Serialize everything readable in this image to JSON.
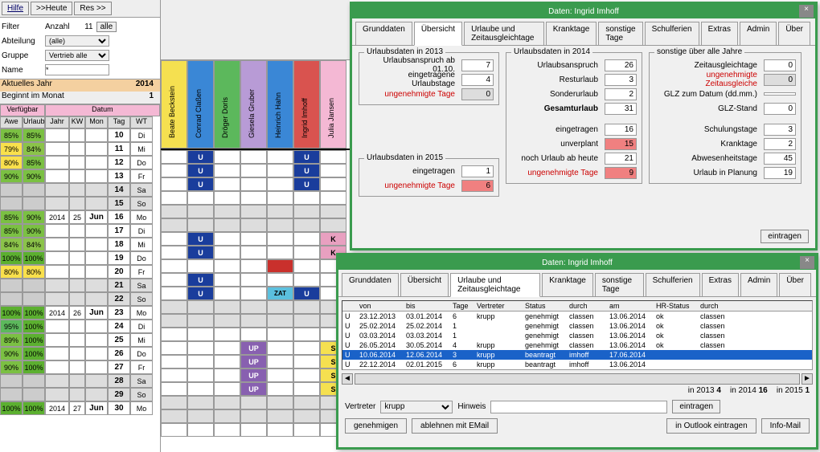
{
  "buttons": {
    "hilfe": "Hilfe",
    "heute": ">>Heute",
    "res": "Res >>",
    "alle": "alle"
  },
  "filter": {
    "label": "Filter",
    "anzahl_lbl": "Anzahl",
    "anzahl": "11",
    "abteilung_lbl": "Abteilung",
    "abteilung": "(alle)",
    "gruppe_lbl": "Gruppe",
    "gruppe": "Vertrieb alle",
    "name_lbl": "Name",
    "name": "*"
  },
  "year": {
    "jahr_lbl": "Aktuelles Jahr",
    "jahr": "2014",
    "beginn_lbl": "Beginnt im Monat",
    "beginn": "1"
  },
  "pink": {
    "verfugbar": "Verfügbar",
    "datum": "Datum"
  },
  "gh": {
    "awe": "Awe",
    "urlaub": "Urlaub",
    "jahr": "Jahr",
    "kw": "KW",
    "mon": "Mon",
    "tag": "Tag",
    "wt": "WT"
  },
  "rows": [
    {
      "a": "85%",
      "b": "85%",
      "j": "",
      "kw": "",
      "m": "",
      "t": "10",
      "w": "Di",
      "ac": "g85",
      "bc": "g85"
    },
    {
      "a": "79%",
      "b": "84%",
      "j": "",
      "kw": "",
      "m": "",
      "t": "11",
      "w": "Mi",
      "ac": "g79",
      "bc": "g84"
    },
    {
      "a": "80%",
      "b": "85%",
      "j": "",
      "kw": "",
      "m": "",
      "t": "12",
      "w": "Do",
      "ac": "g80",
      "bc": "g85"
    },
    {
      "a": "90%",
      "b": "90%",
      "j": "",
      "kw": "",
      "m": "",
      "t": "13",
      "w": "Fr",
      "ac": "g90",
      "bc": "g90"
    },
    {
      "a": "",
      "b": "",
      "j": "",
      "kw": "",
      "m": "",
      "t": "14",
      "w": "Sa",
      "ac": "gray",
      "bc": "gray",
      "gray": true
    },
    {
      "a": "",
      "b": "",
      "j": "",
      "kw": "",
      "m": "",
      "t": "15",
      "w": "So",
      "ac": "gray",
      "bc": "gray",
      "gray": true
    },
    {
      "a": "85%",
      "b": "90%",
      "j": "2014",
      "kw": "25",
      "m": "Jun",
      "t": "16",
      "w": "Mo",
      "ac": "g85",
      "bc": "g90"
    },
    {
      "a": "85%",
      "b": "90%",
      "j": "",
      "kw": "",
      "m": "",
      "t": "17",
      "w": "Di",
      "ac": "g85",
      "bc": "g90"
    },
    {
      "a": "84%",
      "b": "84%",
      "j": "",
      "kw": "",
      "m": "",
      "t": "18",
      "w": "Mi",
      "ac": "g84",
      "bc": "g84"
    },
    {
      "a": "100%",
      "b": "100%",
      "j": "",
      "kw": "",
      "m": "",
      "t": "19",
      "w": "Do",
      "ac": "g100",
      "bc": "g100"
    },
    {
      "a": "80%",
      "b": "80%",
      "j": "",
      "kw": "",
      "m": "",
      "t": "20",
      "w": "Fr",
      "ac": "g80",
      "bc": "g80"
    },
    {
      "a": "",
      "b": "",
      "j": "",
      "kw": "",
      "m": "",
      "t": "21",
      "w": "Sa",
      "ac": "gray",
      "bc": "gray",
      "gray": true
    },
    {
      "a": "",
      "b": "",
      "j": "",
      "kw": "",
      "m": "",
      "t": "22",
      "w": "So",
      "ac": "gray",
      "bc": "gray",
      "gray": true
    },
    {
      "a": "100%",
      "b": "100%",
      "j": "2014",
      "kw": "26",
      "m": "Jun",
      "t": "23",
      "w": "Mo",
      "ac": "g100",
      "bc": "g100"
    },
    {
      "a": "95%",
      "b": "100%",
      "j": "",
      "kw": "",
      "m": "",
      "t": "24",
      "w": "Di",
      "ac": "g95",
      "bc": "g100"
    },
    {
      "a": "89%",
      "b": "100%",
      "j": "",
      "kw": "",
      "m": "",
      "t": "25",
      "w": "Mi",
      "ac": "g89",
      "bc": "g100"
    },
    {
      "a": "90%",
      "b": "100%",
      "j": "",
      "kw": "",
      "m": "",
      "t": "26",
      "w": "Do",
      "ac": "g90",
      "bc": "g100"
    },
    {
      "a": "90%",
      "b": "100%",
      "j": "",
      "kw": "",
      "m": "",
      "t": "27",
      "w": "Fr",
      "ac": "g90",
      "bc": "g100"
    },
    {
      "a": "",
      "b": "",
      "j": "",
      "kw": "",
      "m": "",
      "t": "28",
      "w": "Sa",
      "ac": "gray",
      "bc": "gray",
      "gray": true
    },
    {
      "a": "",
      "b": "",
      "j": "",
      "kw": "",
      "m": "",
      "t": "29",
      "w": "So",
      "ac": "gray",
      "bc": "gray",
      "gray": true
    },
    {
      "a": "100%",
      "b": "100%",
      "j": "2014",
      "kw": "27",
      "m": "Jun",
      "t": "30",
      "w": "Mo",
      "ac": "g100",
      "bc": "g100"
    }
  ],
  "people": [
    "Beate Beckstein",
    "Conrad Claßen",
    "Dröger Doris",
    "Giesela Gruber",
    "Heinrich Hahn",
    "Ingrid Imhoff",
    "Julia Jansen"
  ],
  "pcolors": [
    "c-yellow",
    "c-blue",
    "c-green",
    "c-purple",
    "c-blue",
    "c-red",
    "c-pink"
  ],
  "gantt": [
    [
      "",
      "U",
      "",
      "",
      "",
      "U",
      ""
    ],
    [
      "",
      "U",
      "",
      "",
      "",
      "U",
      ""
    ],
    [
      "",
      "U",
      "",
      "",
      "",
      "U",
      ""
    ],
    [
      "",
      "",
      "",
      "",
      "",
      "",
      ""
    ],
    [
      "g",
      "g",
      "g",
      "g",
      "g",
      "g",
      "g"
    ],
    [
      "g",
      "g",
      "g",
      "g",
      "g",
      "g",
      "g"
    ],
    [
      "",
      "U",
      "",
      "",
      "",
      "",
      "K"
    ],
    [
      "",
      "U",
      "",
      "",
      "",
      "",
      "K"
    ],
    [
      "",
      "",
      "",
      "",
      "r",
      "",
      ""
    ],
    [
      "",
      "U",
      "",
      "",
      "",
      "",
      ""
    ],
    [
      "",
      "U",
      "",
      "",
      "ZAT",
      "U",
      ""
    ],
    [
      "g",
      "g",
      "g",
      "g",
      "g",
      "g",
      "g"
    ],
    [
      "g",
      "g",
      "g",
      "g",
      "g",
      "g",
      "g"
    ],
    [
      "",
      "",
      "",
      "",
      "",
      "",
      ""
    ],
    [
      "",
      "",
      "",
      "UP",
      "",
      "",
      "S"
    ],
    [
      "",
      "",
      "",
      "UP",
      "",
      "",
      "S"
    ],
    [
      "",
      "",
      "",
      "UP",
      "",
      "",
      "S"
    ],
    [
      "",
      "",
      "",
      "UP",
      "",
      "",
      "S"
    ],
    [
      "g",
      "g",
      "g",
      "g",
      "g",
      "g",
      "g"
    ],
    [
      "g",
      "g",
      "g",
      "g",
      "g",
      "g",
      "g"
    ],
    [
      "",
      "",
      "",
      "",
      "",
      "",
      ""
    ]
  ],
  "m1": {
    "title": "Daten: Ingrid Imhoff",
    "tabs": [
      "Grunddaten",
      "Übersicht",
      "Urlaube und Zeitausgleichtage",
      "Kranktage",
      "sonstige Tage",
      "Schulferien",
      "Extras",
      "Admin",
      "Über"
    ],
    "active": 1,
    "f2013": {
      "legend": "Urlaubsdaten in 2013",
      "anspruch_lbl": "Urlaubsanspruch ab 01.10.",
      "anspruch": "7",
      "einget_lbl": "eingetragene Urlaubstage",
      "einget": "4",
      "ungen_lbl": "ungenehmigte Tage",
      "ungen": "0"
    },
    "f2015": {
      "legend": "Urlaubsdaten in 2015",
      "einget_lbl": "eingetragen",
      "einget": "1",
      "ungen_lbl": "ungenehmigte Tage",
      "ungen": "6"
    },
    "f2014": {
      "legend": "Urlaubsdaten in 2014",
      "anspruch_lbl": "Urlaubsanspruch",
      "anspruch": "26",
      "rest_lbl": "Resturlaub",
      "rest": "3",
      "sonder_lbl": "Sonderurlaub",
      "sonder": "2",
      "gesamt_lbl": "Gesamturlaub",
      "gesamt": "31",
      "einget_lbl": "eingetragen",
      "einget": "16",
      "unver_lbl": "unverplant",
      "unver": "15",
      "noch_lbl": "noch Urlaub ab heute",
      "noch": "21",
      "ungen_lbl": "ungenehmigte Tage",
      "ungen": "9"
    },
    "fson": {
      "legend": "sonstige über alle Jahre",
      "zeit_lbl": "Zeitausgleichtage",
      "zeit": "0",
      "uza_lbl": "ungenehmigte Zeitausgleiche",
      "uza": "0",
      "glzd_lbl": "GLZ zum Datum (dd.mm.)",
      "glzd": "",
      "glzs_lbl": "GLZ-Stand",
      "glzs": "0",
      "schul_lbl": "Schulungstage",
      "schul": "3",
      "krank_lbl": "Kranktage",
      "krank": "2",
      "abw_lbl": "Abwesenheitstage",
      "abw": "45",
      "plan_lbl": "Urlaub in Planung",
      "plan": "19"
    },
    "eintragen": "eintragen"
  },
  "m2": {
    "title": "Daten: Ingrid Imhoff",
    "tabs": [
      "Grunddaten",
      "Übersicht",
      "Urlaube und Zeitausgleichtage",
      "Kranktage",
      "sonstige Tage",
      "Schulferien",
      "Extras",
      "Admin",
      "Über"
    ],
    "active": 2,
    "th": [
      "",
      "von",
      "bis",
      "Tage",
      "Vertreter",
      "Status",
      "durch",
      "am",
      "HR-Status",
      "durch"
    ],
    "rows": [
      [
        "U",
        "23.12.2013",
        "03.01.2014",
        "6",
        "krupp",
        "genehmigt",
        "classen",
        "13.06.2014",
        "ok",
        "classen"
      ],
      [
        "U",
        "25.02.2014",
        "25.02.2014",
        "1",
        "",
        "genehmigt",
        "classen",
        "13.06.2014",
        "ok",
        "classen"
      ],
      [
        "U",
        "03.03.2014",
        "03.03.2014",
        "1",
        "",
        "genehmigt",
        "classen",
        "13.06.2014",
        "ok",
        "classen"
      ],
      [
        "U",
        "26.05.2014",
        "30.05.2014",
        "4",
        "krupp",
        "genehmigt",
        "classen",
        "13.06.2014",
        "ok",
        "classen"
      ],
      [
        "U",
        "10.06.2014",
        "12.06.2014",
        "3",
        "krupp",
        "beantragt",
        "imhoff",
        "17.06.2014",
        "",
        ""
      ],
      [
        "U",
        "22.12.2014",
        "02.01.2015",
        "6",
        "krupp",
        "beantragt",
        "imhoff",
        "13.06.2014",
        "",
        ""
      ]
    ],
    "sel": 4,
    "summary": {
      "y13": "in 2013",
      "v13": "4",
      "y14": "in 2014",
      "v14": "16",
      "y15": "in 2015",
      "v15": "1"
    },
    "vertreter_lbl": "Vertreter",
    "vertreter": "krupp",
    "hinweis_lbl": "Hinweis",
    "eintragen": "eintragen",
    "btns": {
      "gen": "genehmigen",
      "abl": "ablehnen mit EMail",
      "out": "in Outlook eintragen",
      "info": "Info-Mail"
    }
  }
}
